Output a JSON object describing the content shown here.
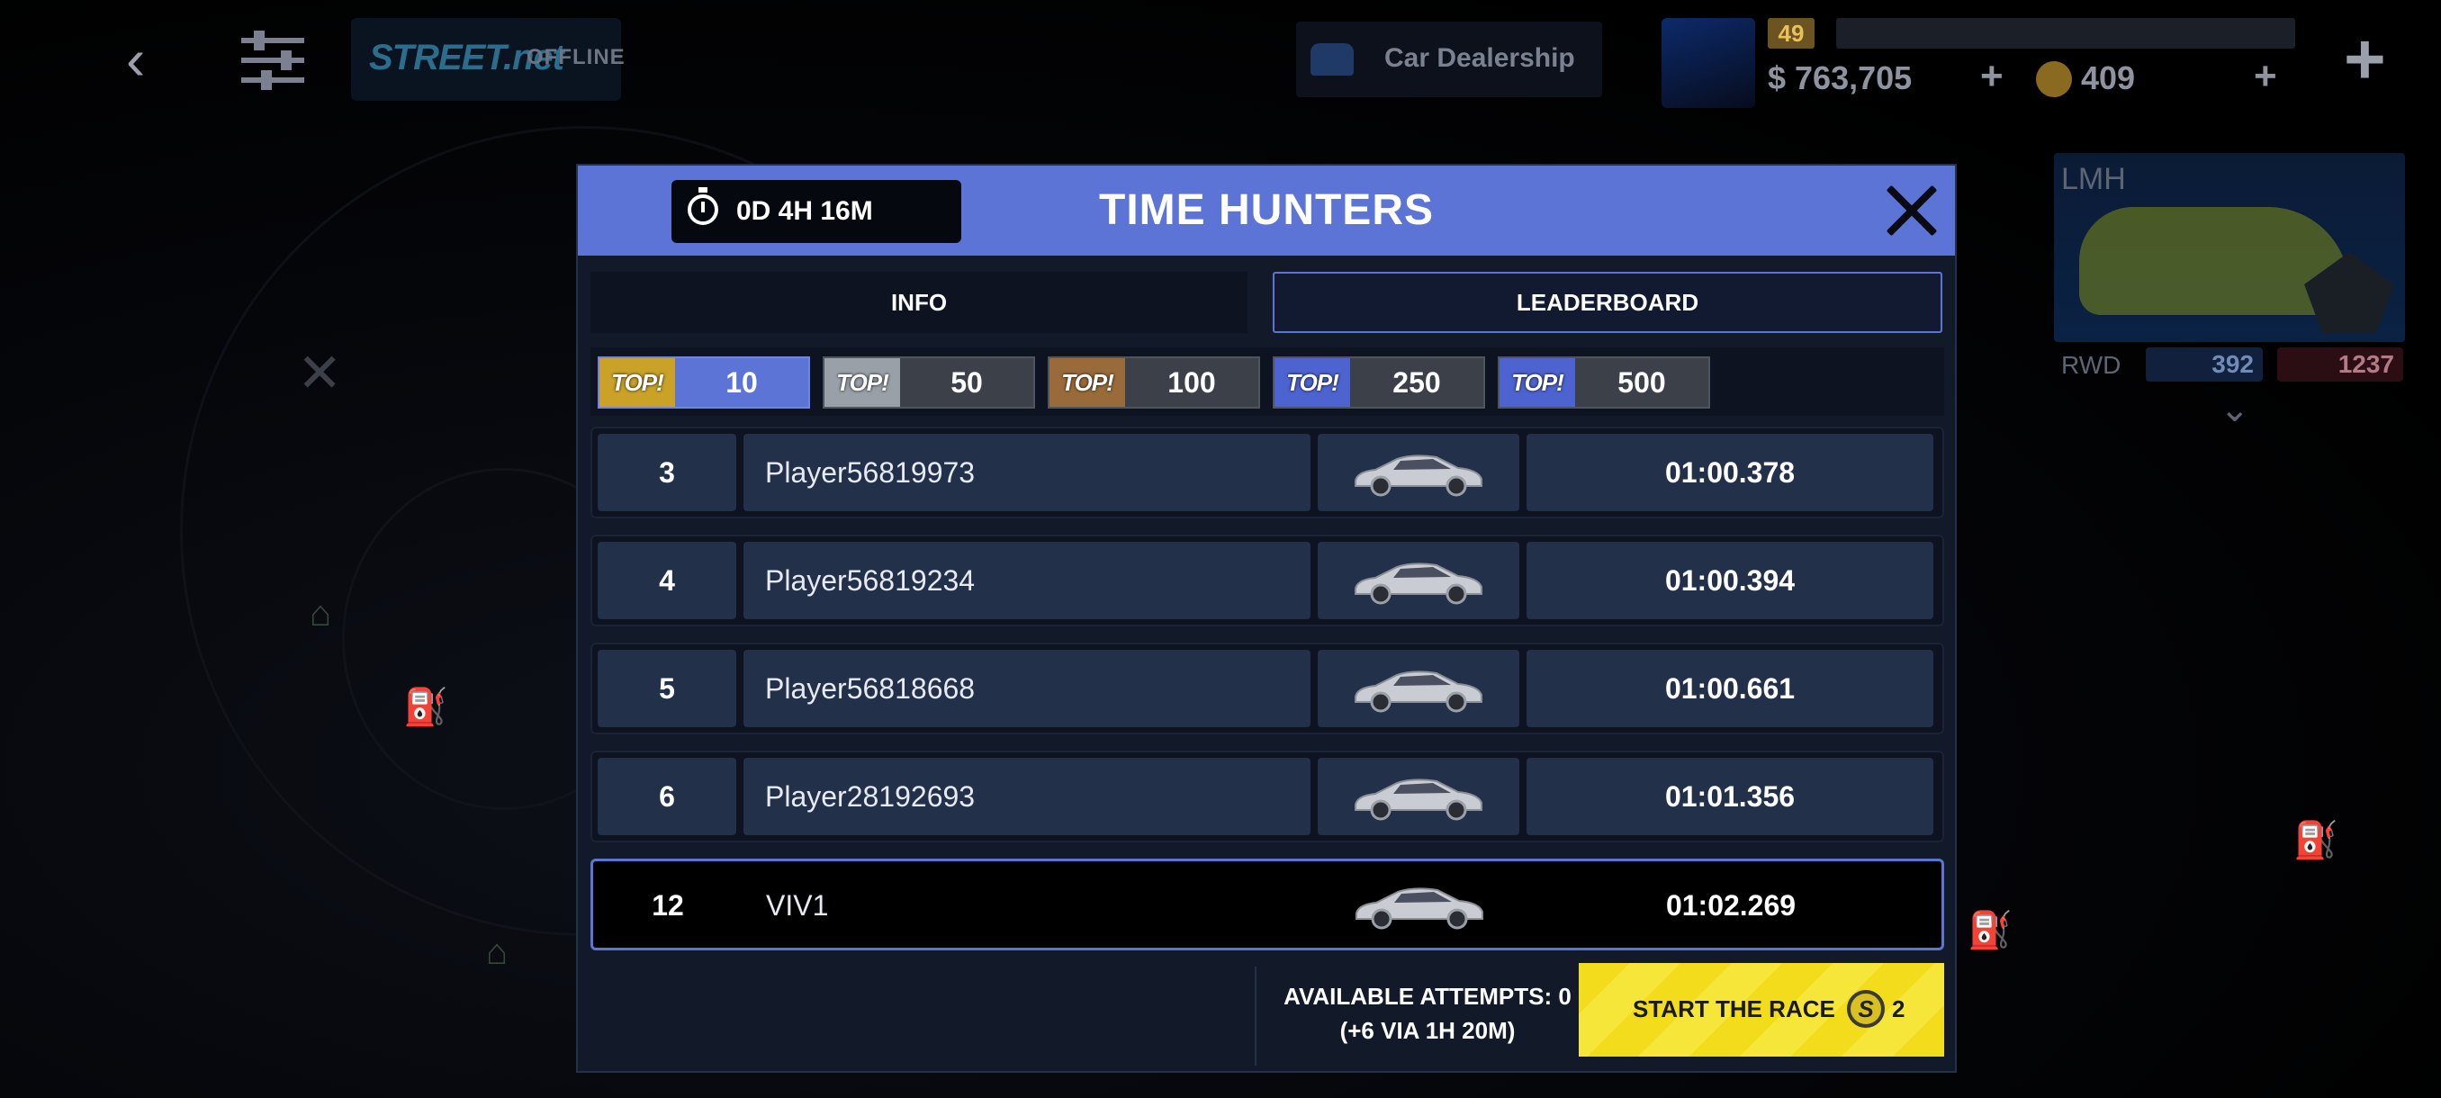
{
  "hud": {
    "logo": "STREET.net",
    "status": "OFFLINE",
    "dealership": "Car Dealership",
    "level": "49",
    "cash": "763,705",
    "gold": "409"
  },
  "car_panel": {
    "class": "LMH",
    "drive": "RWD",
    "stat_blue": "392",
    "stat_red": "1237"
  },
  "modal": {
    "timer": "0D 4H 16M",
    "title": "TIME HUNTERS",
    "tabs": {
      "info": "INFO",
      "leaderboard": "LEADERBOARD"
    },
    "filter_badge": "TOP!",
    "filters": [
      {
        "value": "10",
        "active": true,
        "color": "#c9a227"
      },
      {
        "value": "50",
        "active": false,
        "color": "#9aa0a8"
      },
      {
        "value": "100",
        "active": false,
        "color": "#9a6b3a"
      },
      {
        "value": "250",
        "active": false,
        "color": "#4d63d0"
      },
      {
        "value": "500",
        "active": false,
        "color": "#4d63d0"
      }
    ],
    "rows": [
      {
        "rank": "3",
        "name": "Player56819973",
        "time": "01:00.378"
      },
      {
        "rank": "4",
        "name": "Player56819234",
        "time": "01:00.394"
      },
      {
        "rank": "5",
        "name": "Player56818668",
        "time": "01:00.661"
      },
      {
        "rank": "6",
        "name": "Player28192693",
        "time": "01:01.356"
      },
      {
        "rank": "12",
        "name": "VIV1",
        "time": "01:02.269",
        "is_player": true
      }
    ],
    "attempts_line1": "AVAILABLE ATTEMPTS: 0",
    "attempts_line2": "(+6 VIA 1H 20M)",
    "start_label": "START THE RACE",
    "start_cost": "2"
  },
  "colors": {
    "accent": "#5b74d6",
    "start_button": "#f2dc1c"
  }
}
